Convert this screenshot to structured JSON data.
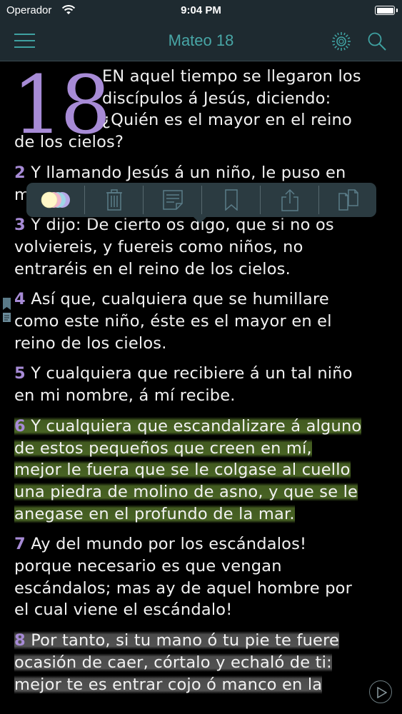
{
  "status_bar": {
    "carrier": "Operador",
    "time": "9:04 PM"
  },
  "nav": {
    "title": "Mateo 18"
  },
  "chapter": {
    "number": "18"
  },
  "verses": [
    {
      "num": "",
      "lines": [
        "EN aquel tiempo se llegaron los",
        "discípulos á Jesús, diciendo:",
        "¿Quién es el mayor en el reino",
        "de los cielos?"
      ]
    },
    {
      "num": "2",
      "lines": [
        "Y llamando Jesús á un niño, le puso en",
        "m"
      ]
    },
    {
      "num": "3",
      "lines": [
        "Y dijo: De cierto os digo, que si no os",
        "volviereis, y fuereis como niños, no",
        "entraréis en el reino de los cielos."
      ]
    },
    {
      "num": "4",
      "lines": [
        "Así que, cualquiera que se humillare",
        "como este niño, éste es el mayor en el",
        "reino de los cielos."
      ]
    },
    {
      "num": "5",
      "lines": [
        "Y cualquiera que recibiere á un tal niño",
        "en mi nombre, á mí recibe."
      ]
    },
    {
      "num": "6",
      "lines": [
        "Y cualquiera que escandalizare á alguno",
        "de estos pequeños que creen en mí,",
        "mejor le fuera que se le colgase al cuello",
        "una piedra de molino de asno, y que se le",
        "anegase en el profundo de la mar."
      ]
    },
    {
      "num": "7",
      "lines": [
        "Ay del mundo por los escándalos!",
        "porque necesario es que vengan",
        "escándalos; mas ay de aquel hombre por",
        "el cual viene el escándalo!"
      ]
    },
    {
      "num": "8",
      "lines": [
        "Por tanto, si tu mano ó tu pie te fuere",
        "ocasión de caer, córtalo y echaló de ti:",
        "mejor te es entrar cojo ó manco en la"
      ]
    }
  ],
  "popup_actions": [
    "highlight-colors",
    "delete",
    "note",
    "bookmark",
    "share",
    "copy"
  ],
  "colors": {
    "accent": "#48a6a6",
    "verse_number": "#a78bd6",
    "highlight_green": "#4c6826",
    "highlight_gray": "#565656",
    "bar_bg": "#1e2a30"
  }
}
